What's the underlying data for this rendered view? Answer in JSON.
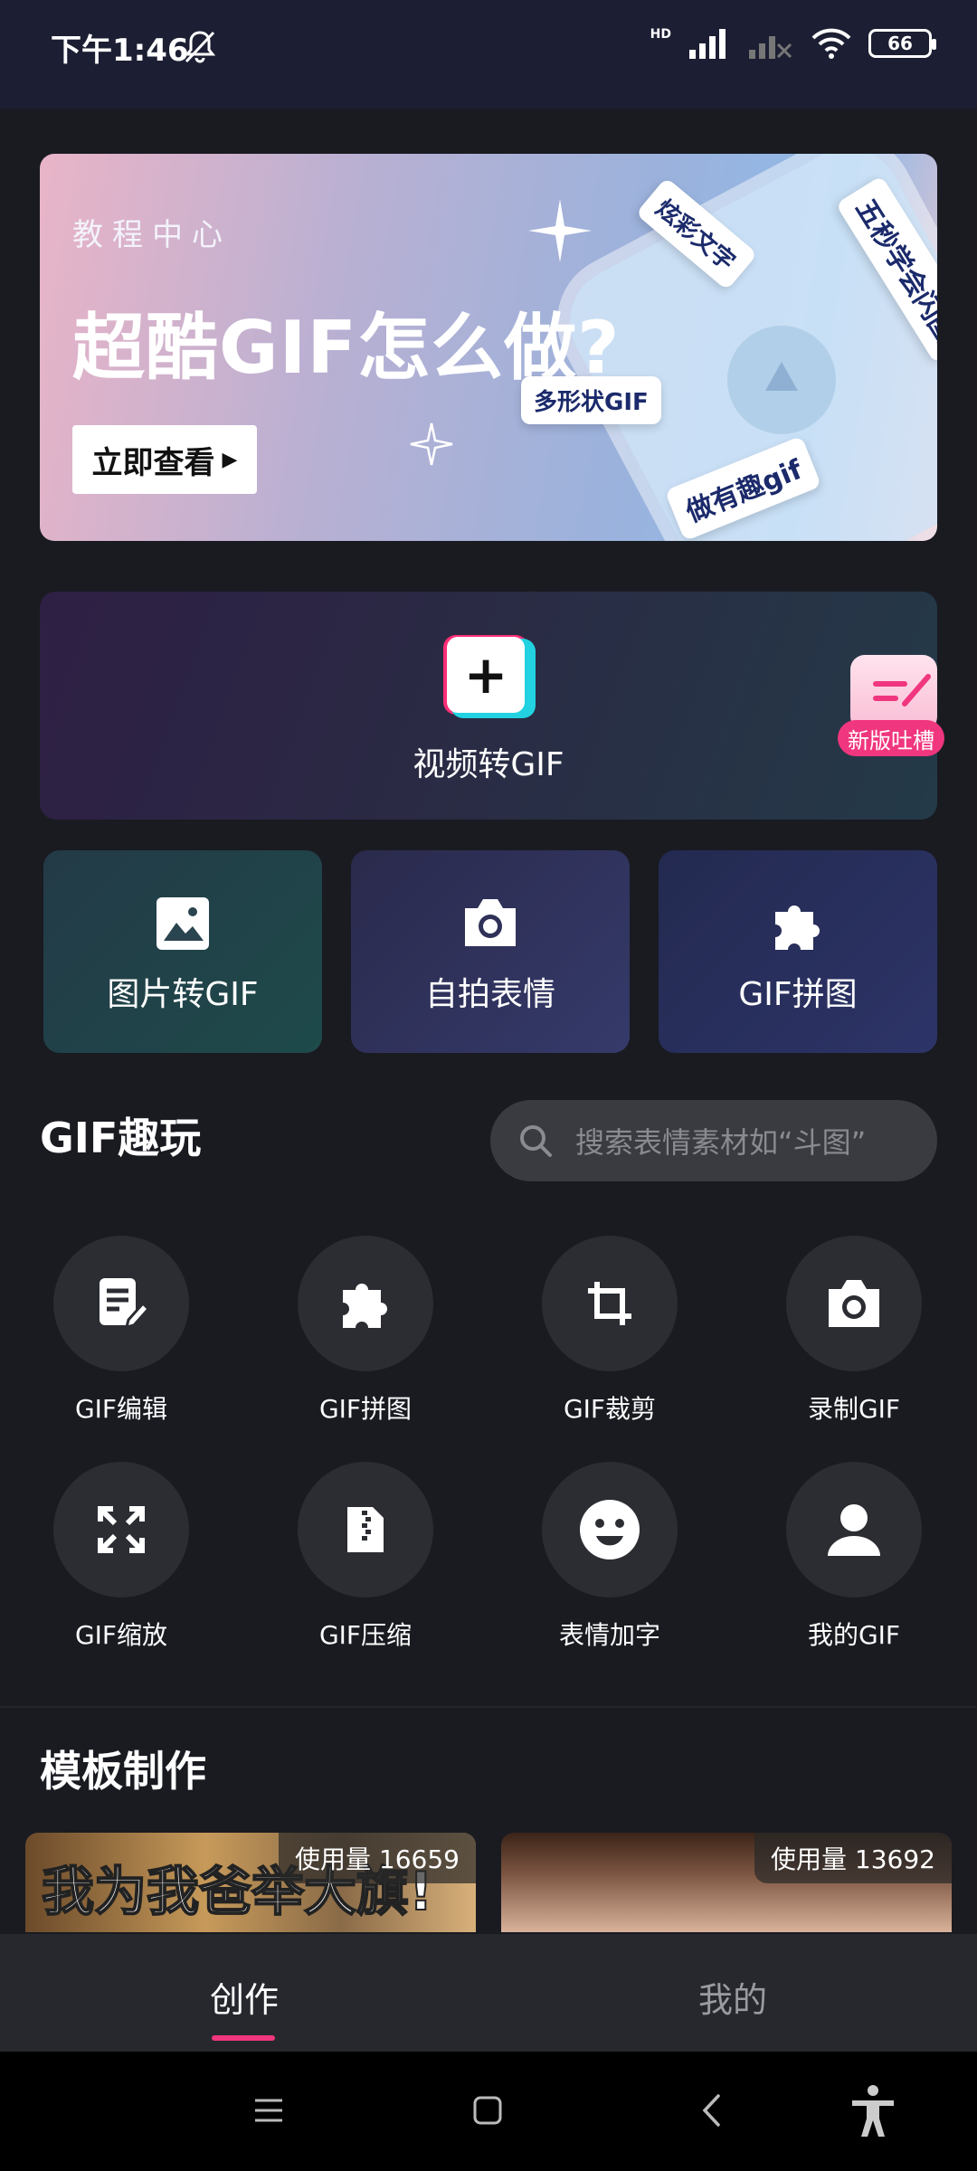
{
  "status_bar": {
    "time": "下午1:46",
    "battery": "66",
    "network_label": "HD"
  },
  "banner": {
    "subtitle": "教程中心",
    "title": "超酷GIF怎么做?",
    "button_label": "立即查看",
    "tags": [
      "炫彩文字",
      "五秒学会闪图",
      "多形状GIF",
      "做有趣gif"
    ]
  },
  "video_card": {
    "label": "视频转GIF",
    "feedback_badge": "新版吐槽"
  },
  "tiles": [
    {
      "label": "图片转GIF",
      "icon": "image-icon"
    },
    {
      "label": "自拍表情",
      "icon": "camera-icon"
    },
    {
      "label": "GIF拼图",
      "icon": "puzzle-icon"
    }
  ],
  "fun_section": {
    "title": "GIF趣玩",
    "search_placeholder": "搜索表情素材如“斗图”"
  },
  "tools": [
    {
      "label": "GIF编辑",
      "icon": "edit-icon"
    },
    {
      "label": "GIF拼图",
      "icon": "puzzle-icon"
    },
    {
      "label": "GIF裁剪",
      "icon": "crop-icon"
    },
    {
      "label": "录制GIF",
      "icon": "camera-icon"
    },
    {
      "label": "GIF缩放",
      "icon": "expand-icon"
    },
    {
      "label": "GIF压缩",
      "icon": "zip-file-icon"
    },
    {
      "label": "表情加字",
      "icon": "smiley-icon"
    },
    {
      "label": "我的GIF",
      "icon": "person-icon"
    }
  ],
  "templates": {
    "title": "模板制作",
    "items": [
      {
        "usage": "使用量 16659",
        "caption": "我为我爸举大旗!"
      },
      {
        "usage": "使用量 13692",
        "caption": ""
      }
    ]
  },
  "bottom_nav": {
    "items": [
      "创作",
      "我的"
    ],
    "active": "创作"
  },
  "colors": {
    "background": "#191b21",
    "accent": "#f0367e",
    "status_bar": "#1c1f33"
  }
}
